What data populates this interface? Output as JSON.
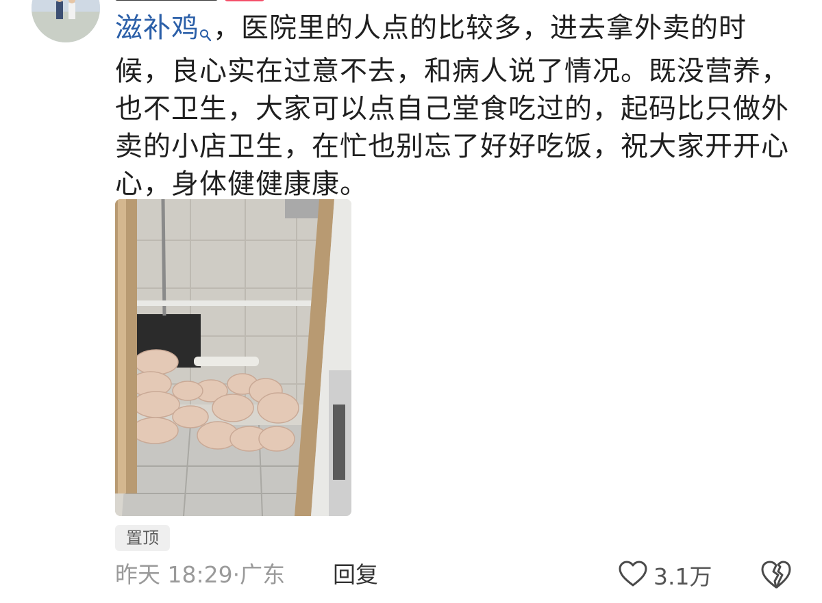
{
  "comment": {
    "topic_link": "滋补鸡",
    "text": "，医院里的人点的比较多，进去拿外卖的时候，良心实在过意不去，和病人说了情况。既没营养，也不卫生，大家可以点自己堂食吃过的，起码比只做外卖的小店卫生，在忙也别忘了好好吃饭，祝大家开开心心，身体健健康康。",
    "pinned_label": "置顶",
    "time": "昨天 18:29",
    "location": "广东",
    "reply_label": "回复",
    "like_count": "3.1万"
  },
  "icons": {
    "search": "search-icon",
    "like": "heart-outline-icon",
    "dislike": "broken-heart-icon"
  },
  "colors": {
    "link": "#2b5fa8",
    "text": "#1f1f1f",
    "meta": "#9a9a9a",
    "tag_bg": "#efefef",
    "badge": "#f4506a"
  }
}
